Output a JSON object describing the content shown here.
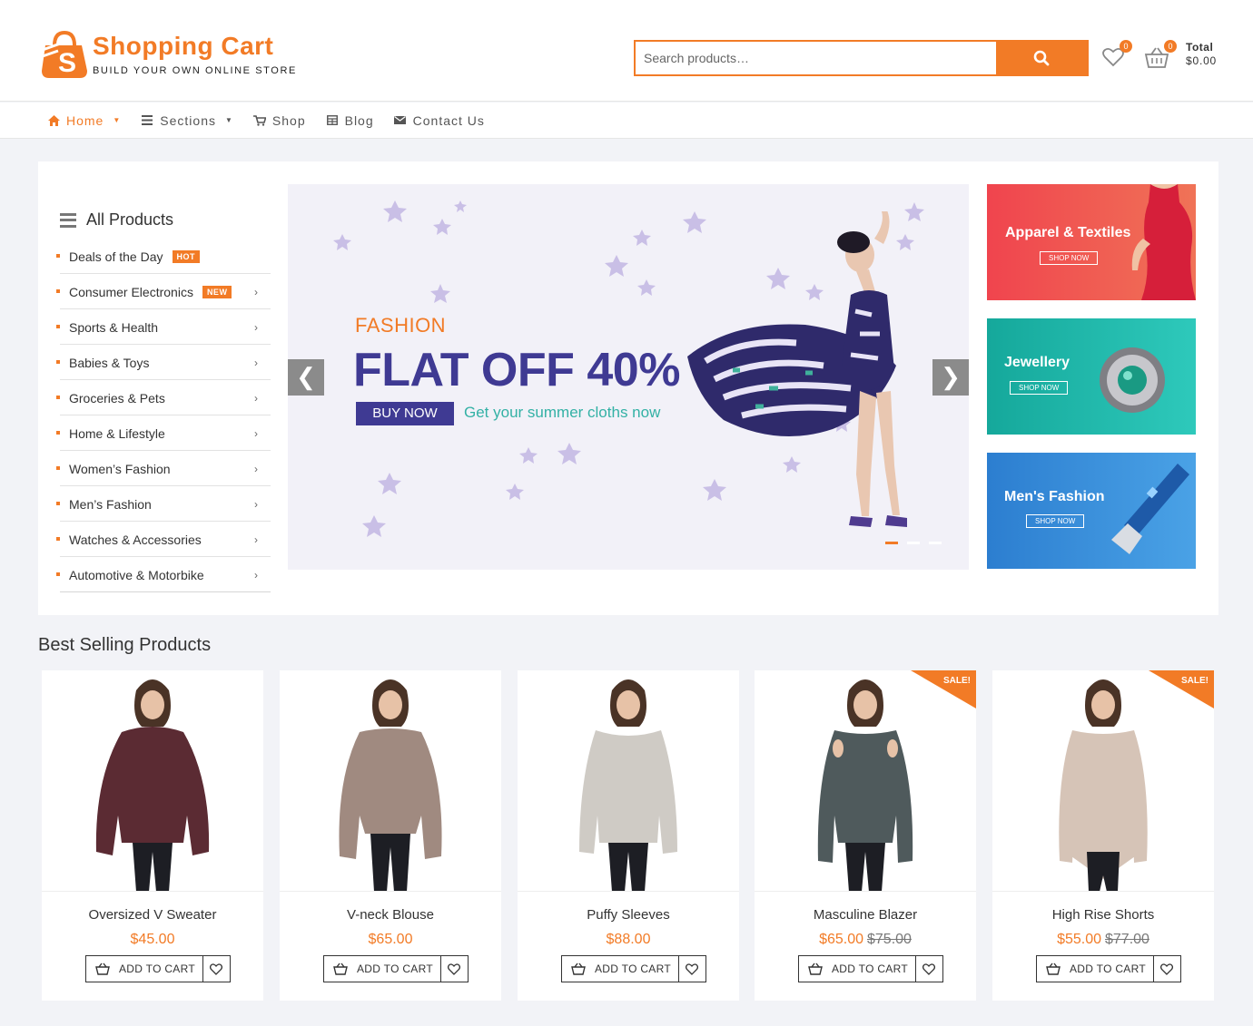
{
  "brand": {
    "title": "Shopping Cart",
    "tagline": "BUILD YOUR OWN ONLINE STORE",
    "color": "#f27b26"
  },
  "search": {
    "placeholder": "Search products…"
  },
  "header": {
    "wishlist_count": "0",
    "cart_count": "0",
    "total_label": "Total",
    "total_value": "$0.00"
  },
  "nav": [
    {
      "label": "Home",
      "icon": "home-icon",
      "active": true,
      "dropdown": true
    },
    {
      "label": "Sections",
      "icon": "sections-icon",
      "dropdown": true
    },
    {
      "label": "Shop",
      "icon": "cart-icon"
    },
    {
      "label": "Blog",
      "icon": "blog-icon"
    },
    {
      "label": "Contact Us",
      "icon": "envelope-icon"
    }
  ],
  "categories": {
    "title": "All Products",
    "items": [
      {
        "label": "Deals of the Day",
        "badge": "HOT"
      },
      {
        "label": "Consumer Electronics",
        "badge": "NEW"
      },
      {
        "label": "Sports & Health"
      },
      {
        "label": "Babies & Toys"
      },
      {
        "label": "Groceries & Pets"
      },
      {
        "label": "Home & Lifestyle"
      },
      {
        "label": "Women’s Fashion"
      },
      {
        "label": "Men’s Fashion"
      },
      {
        "label": "Watches & Accessories"
      },
      {
        "label": "Automotive & Motorbike"
      }
    ]
  },
  "slider": {
    "kicker": "FASHION",
    "headline": "FLAT OFF 40%",
    "button": "BUY NOW",
    "subtitle": "Get your summer cloths now",
    "prev": "❮",
    "next": "❯"
  },
  "banners": [
    {
      "title": "Apparel & Textiles",
      "cta": "SHOP NOW"
    },
    {
      "title": "Jewellery",
      "cta": "SHOP NOW"
    },
    {
      "title": "Men's Fashion",
      "cta": "SHOP NOW"
    }
  ],
  "best": {
    "title": "Best Selling Products",
    "add_label": "ADD TO CART",
    "sale_label": "SALE!",
    "products": [
      {
        "name": "Oversized V Sweater",
        "price": "$45.00",
        "old": ""
      },
      {
        "name": "V-neck Blouse",
        "price": "$65.00",
        "old": ""
      },
      {
        "name": "Puffy Sleeves",
        "price": "$88.00",
        "old": ""
      },
      {
        "name": "Masculine Blazer",
        "price": "$65.00",
        "old": "$75.00"
      },
      {
        "name": "High Rise Shorts",
        "price": "$55.00",
        "old": "$77.00"
      }
    ]
  }
}
